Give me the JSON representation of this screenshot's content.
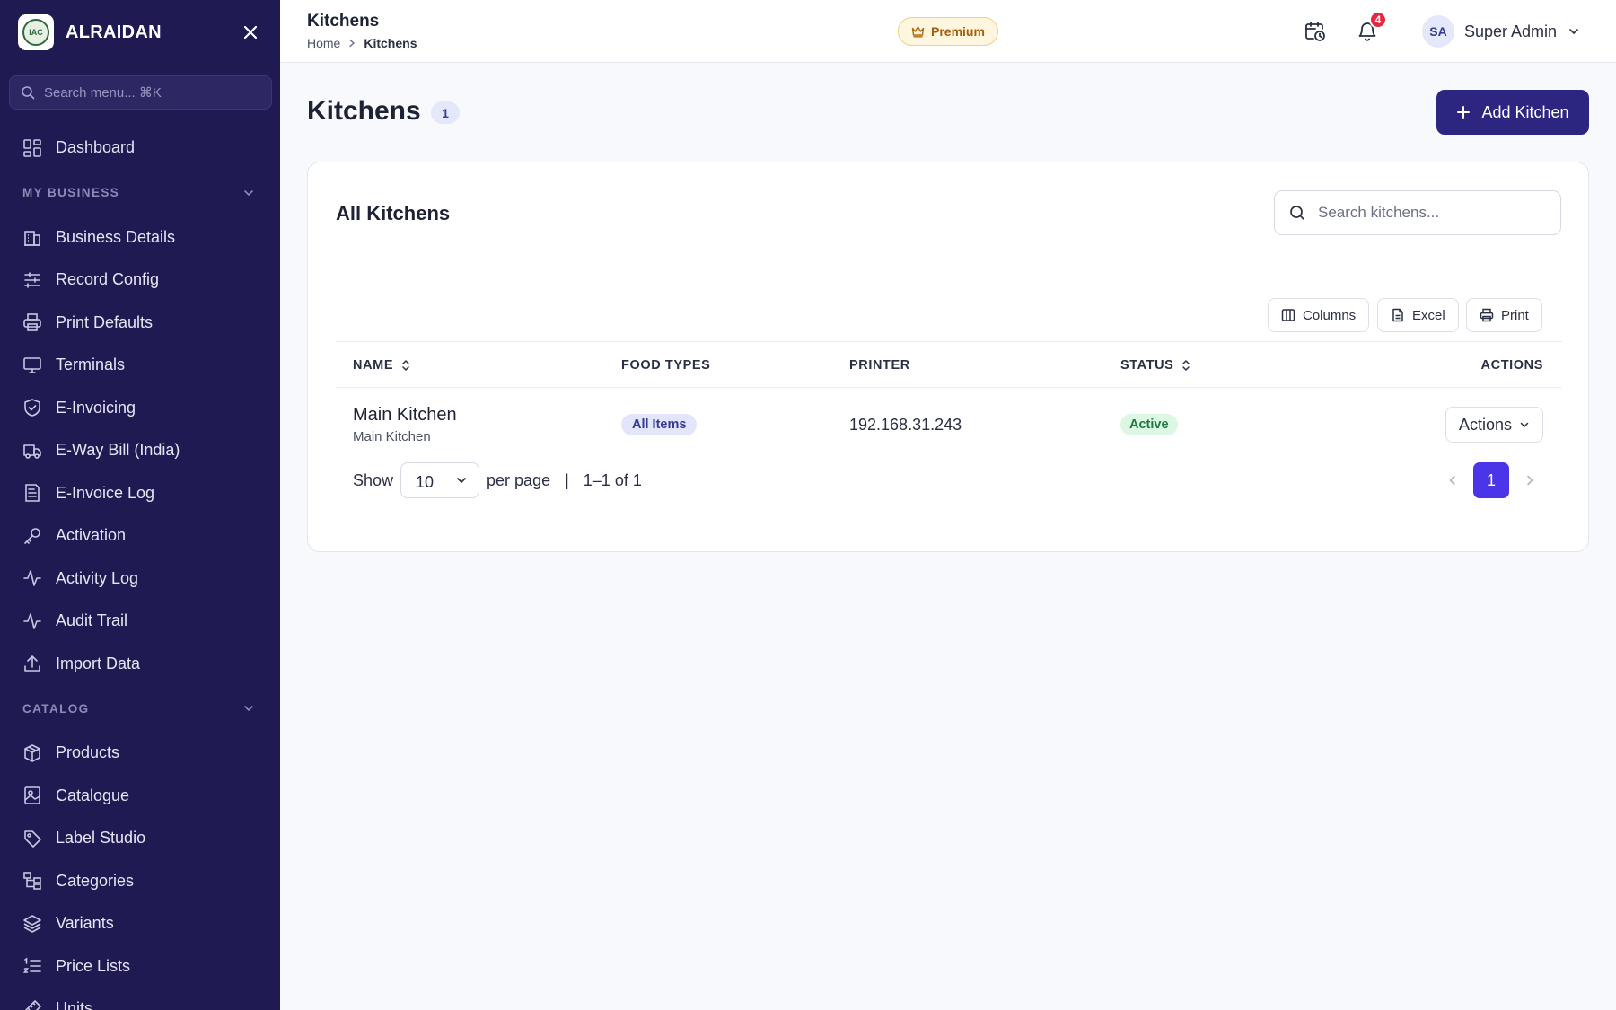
{
  "sidebar": {
    "brand": "ALRAIDAN",
    "logo_text": "IAC",
    "search_placeholder": "Search menu... ⌘K",
    "dashboard": "Dashboard",
    "sections": [
      {
        "title": "MY BUSINESS",
        "items": [
          {
            "label": "Business Details",
            "icon": "building-icon"
          },
          {
            "label": "Record Config",
            "icon": "sliders-icon"
          },
          {
            "label": "Print Defaults",
            "icon": "printer-icon"
          },
          {
            "label": "Terminals",
            "icon": "monitor-icon"
          },
          {
            "label": "E-Invoicing",
            "icon": "shield-check-icon"
          },
          {
            "label": "E-Way Bill (India)",
            "icon": "truck-icon"
          },
          {
            "label": "E-Invoice Log",
            "icon": "receipt-icon"
          },
          {
            "label": "Activation",
            "icon": "key-icon"
          },
          {
            "label": "Activity Log",
            "icon": "activity-icon"
          },
          {
            "label": "Audit Trail",
            "icon": "activity-icon"
          },
          {
            "label": "Import Data",
            "icon": "upload-icon"
          }
        ]
      },
      {
        "title": "CATALOG",
        "items": [
          {
            "label": "Products",
            "icon": "box-icon"
          },
          {
            "label": "Catalogue",
            "icon": "image-book-icon"
          },
          {
            "label": "Label Studio",
            "icon": "tag-icon"
          },
          {
            "label": "Categories",
            "icon": "category-tree-icon"
          },
          {
            "label": "Variants",
            "icon": "layers-icon"
          },
          {
            "label": "Price Lists",
            "icon": "list-ordered-icon"
          },
          {
            "label": "Units",
            "icon": "ruler-icon"
          }
        ]
      }
    ]
  },
  "topbar": {
    "title": "Kitchens",
    "breadcrumb": [
      "Home",
      "Kitchens"
    ],
    "premium_label": "Premium",
    "notification_count": "4",
    "user_initials": "SA",
    "user_name": "Super Admin"
  },
  "main": {
    "title": "Kitchens",
    "count": "1",
    "add_button": "Add Kitchen",
    "card": {
      "title": "All Kitchens",
      "search_placeholder": "Search kitchens...",
      "tools": [
        "Columns",
        "Excel",
        "Print"
      ],
      "columns": [
        "NAME",
        "FOOD TYPES",
        "PRINTER",
        "STATUS",
        "ACTIONS"
      ],
      "rows": [
        {
          "name": "Main Kitchen",
          "subtitle": "Main Kitchen",
          "food_types": "All Items",
          "printer": "192.168.31.243",
          "status": "Active",
          "actions": "Actions"
        }
      ],
      "pagination": {
        "show_label": "Show",
        "per_page_value": "10",
        "per_page_label": "per page",
        "separator": "|",
        "range": "1–1 of 1",
        "current_page": "1"
      }
    }
  },
  "colors": {
    "sidebar_bg": "#1f1a52",
    "primary_button": "#2c2680",
    "active_page": "#4a36e8",
    "status_active": "#1f7a3f",
    "notification": "#e5283f"
  }
}
